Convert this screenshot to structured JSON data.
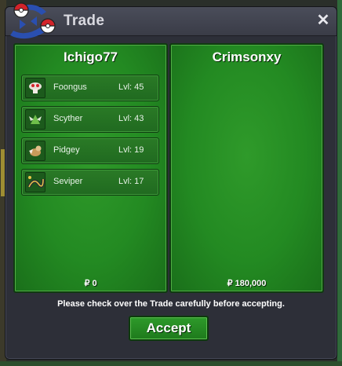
{
  "window": {
    "title": "Trade"
  },
  "left_panel": {
    "player": "Ichigo77",
    "currency_symbol": "₽",
    "money": "0",
    "pokemon": [
      {
        "name": "Foongus",
        "level": "Lvl: 45",
        "icon": "foongus-icon"
      },
      {
        "name": "Scyther",
        "level": "Lvl: 43",
        "icon": "scyther-icon"
      },
      {
        "name": "Pidgey",
        "level": "Lvl: 19",
        "icon": "pidgey-icon"
      },
      {
        "name": "Seviper",
        "level": "Lvl: 17",
        "icon": "seviper-icon"
      }
    ]
  },
  "right_panel": {
    "player": "Crimsonxy",
    "currency_symbol": "₽",
    "money": "180,000"
  },
  "notice": "Please check over the Trade carefully before accepting.",
  "accept_label": "Accept",
  "colors": {
    "panel_green": "#238a22",
    "window_bg": "#2d2f38",
    "accent_red": "#d2232a"
  }
}
